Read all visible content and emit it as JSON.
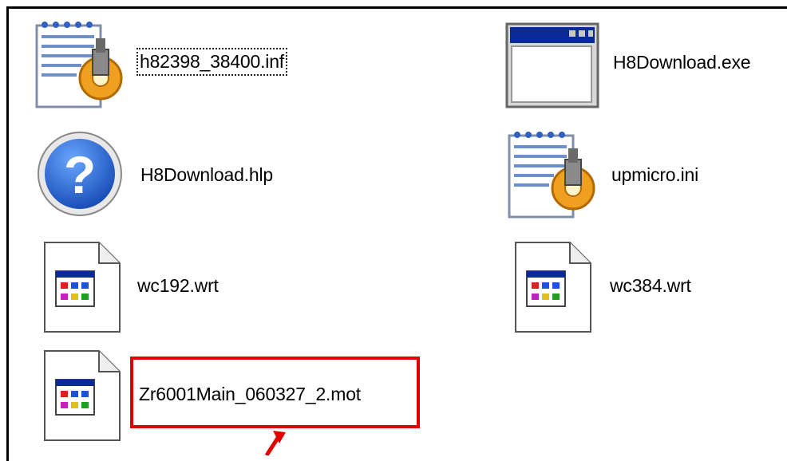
{
  "files": [
    {
      "name": "h82398_38400.inf",
      "icon": "setup-info-icon"
    },
    {
      "name": "H8Download.exe",
      "icon": "application-window-icon"
    },
    {
      "name": "H8Download.hlp",
      "icon": "help-icon"
    },
    {
      "name": "upmicro.ini",
      "icon": "settings-file-icon"
    },
    {
      "name": "wc192.wrt",
      "icon": "document-file-icon"
    },
    {
      "name": "wc384.wrt",
      "icon": "document-file-icon"
    },
    {
      "name": "Zr6001Main_060327_2.mot",
      "icon": "document-file-icon"
    }
  ],
  "colors": {
    "highlight": "#e00000",
    "help_blue": "#1f5fc9",
    "title_bar": "#0a2a9a"
  }
}
